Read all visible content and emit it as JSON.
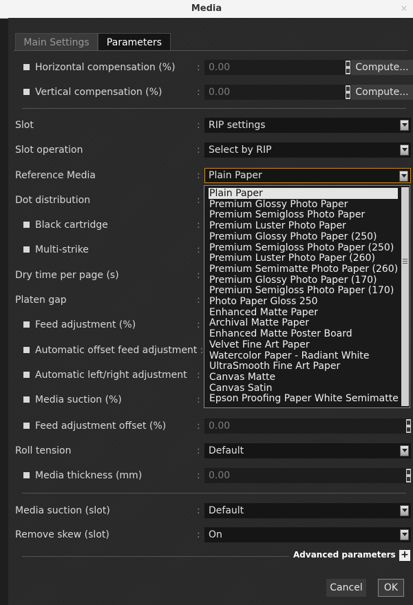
{
  "window": {
    "title": "Media",
    "close": "×"
  },
  "tabs": {
    "main": "Main Settings",
    "params": "Parameters"
  },
  "params": {
    "horiz_comp": {
      "label": "Horizontal compensation (%)",
      "value": "0.00",
      "button": "Compute..."
    },
    "vert_comp": {
      "label": "Vertical compensation (%)",
      "value": "0.00",
      "button": "Compute..."
    },
    "slot": {
      "label": "Slot",
      "value": "RIP settings"
    },
    "slot_op": {
      "label": "Slot operation",
      "value": "Select by RIP"
    },
    "ref_media": {
      "label": "Reference Media",
      "value": "Plain Paper"
    },
    "dot_dist": {
      "label": "Dot distribution"
    },
    "black_cart": {
      "label": "Black cartridge"
    },
    "multi_strike": {
      "label": "Multi-strike"
    },
    "dry_time": {
      "label": "Dry time per page (s)"
    },
    "platen_gap": {
      "label": "Platen gap"
    },
    "feed_adj": {
      "label": "Feed adjustment (%)"
    },
    "auto_offset": {
      "label": "Automatic offset feed adjustment"
    },
    "auto_lr": {
      "label": "Automatic left/right adjustment"
    },
    "media_suction": {
      "label": "Media suction (%)"
    },
    "feed_adj_offset": {
      "label": "Feed adjustment offset (%)",
      "value": "0.00"
    },
    "roll_tension": {
      "label": "Roll tension",
      "value": "Default"
    },
    "media_thick": {
      "label": "Media thickness (mm)",
      "value": "0.00"
    },
    "media_suction_slot": {
      "label": "Media suction (slot)",
      "value": "Default"
    },
    "remove_skew": {
      "label": "Remove skew (slot)",
      "value": "On"
    }
  },
  "colon": ":",
  "dropdown_options": [
    "Plain Paper",
    "Premium Glossy Photo Paper",
    "Premium Semigloss Photo Paper",
    "Premium Luster Photo Paper",
    "Premium Glossy Photo Paper (250)",
    "Premium Semigloss Photo Paper (250)",
    "Premium Luster Photo Paper (260)",
    "Premium Semimatte Photo Paper (260)",
    "Premium Glossy Photo Paper (170)",
    "Premium Semigloss Photo Paper (170)",
    "Photo Paper Gloss 250",
    "Enhanced Matte Paper",
    "Archival Matte Paper",
    "Enhanced Matte Poster Board",
    "Velvet Fine Art Paper",
    "Watercolor Paper - Radiant White",
    "UltraSmooth Fine Art Paper",
    "Canvas Matte",
    "Canvas Satin",
    "Epson Proofing Paper White Semimatte"
  ],
  "advanced": {
    "label": "Advanced parameters",
    "plus": "+"
  },
  "buttons": {
    "cancel": "Cancel",
    "ok": "OK"
  },
  "colors": {
    "accent": "#d68a1a",
    "panel": "#2a2a2a",
    "field": "#151515"
  }
}
